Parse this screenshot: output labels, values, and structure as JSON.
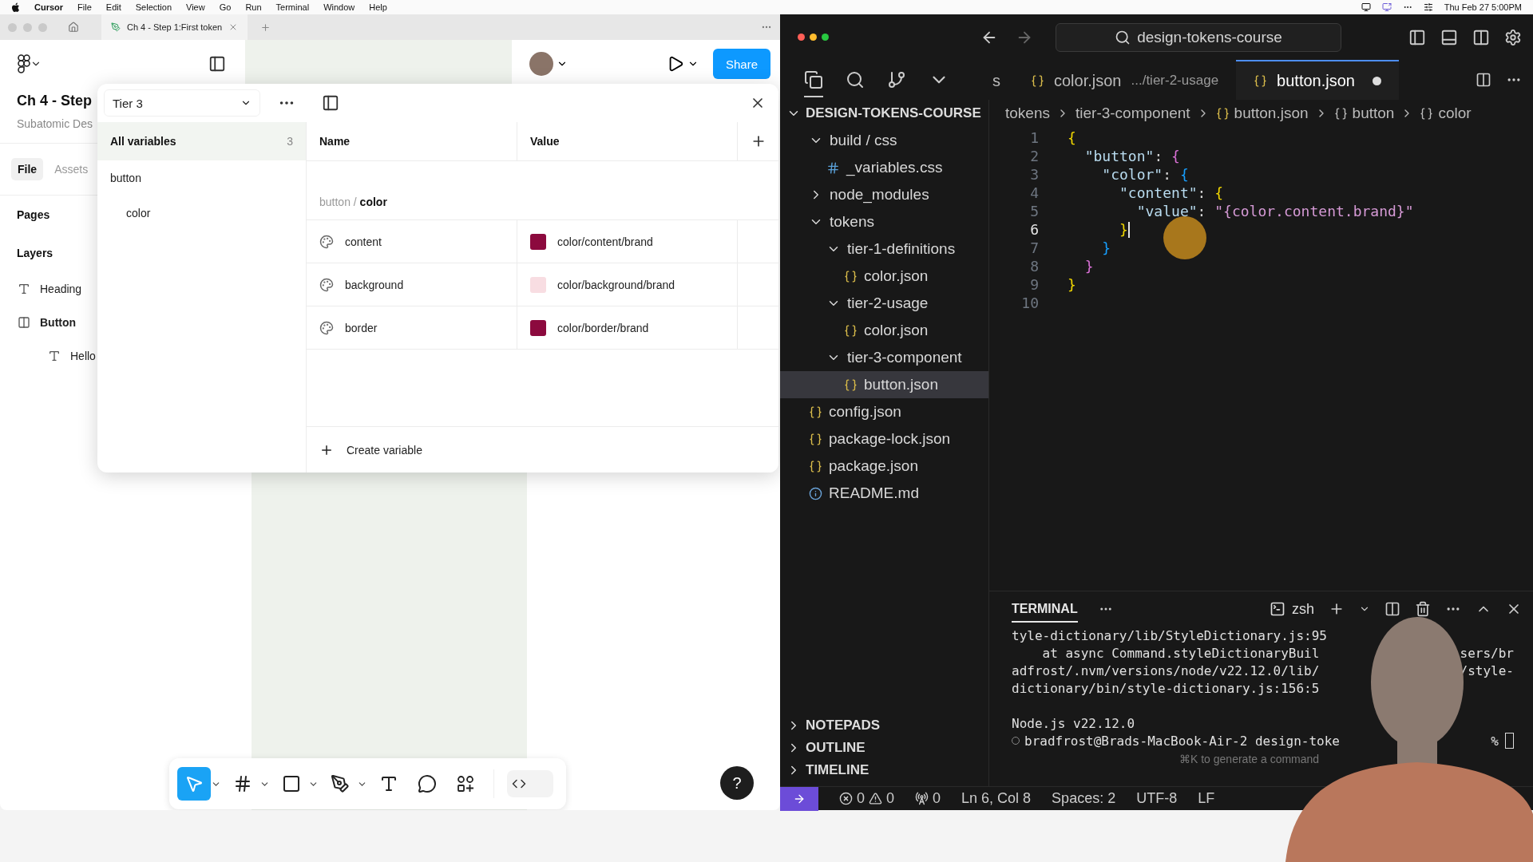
{
  "menu_bar": {
    "app": "Cursor",
    "items": [
      "File",
      "Edit",
      "Selection",
      "View",
      "Go",
      "Run",
      "Terminal",
      "Window",
      "Help"
    ],
    "clock": "Thu Feb 27  5:00PM"
  },
  "figma": {
    "tab": {
      "title": "Ch 4 - Step 1:First token"
    },
    "share": "Share",
    "file_title": "Ch 4 - Step",
    "team": "Subatomic Des",
    "panel_tabs": [
      {
        "label": "File",
        "selected": true
      },
      {
        "label": "Assets",
        "selected": false
      }
    ],
    "pages_label": "Pages",
    "layers_label": "Layers",
    "layers": [
      {
        "kind": "text",
        "name": "Heading",
        "selected": false
      },
      {
        "kind": "frame",
        "name": "Button",
        "selected": true,
        "children": [
          {
            "kind": "text",
            "name": "Hello",
            "selected": false
          }
        ]
      }
    ],
    "variables": {
      "collection": "Tier 3",
      "all": {
        "label": "All variables",
        "count": "3",
        "selected": true
      },
      "groups": [
        {
          "label": "button",
          "selected": false,
          "children": [
            {
              "label": "color",
              "selected": false
            }
          ]
        }
      ],
      "columns": [
        "Name",
        "Value"
      ],
      "path": {
        "parent": "button",
        "separator": "/",
        "current": "color"
      },
      "rows": [
        {
          "name": "content",
          "value": "color/content/brand",
          "color": "#8c0a3e"
        },
        {
          "name": "background",
          "value": "color/background/brand",
          "color": "#f8dde2"
        },
        {
          "name": "border",
          "value": "color/border/brand",
          "color": "#8c0a3e"
        }
      ],
      "create": "Create variable"
    },
    "tools": [
      {
        "kind": "move",
        "selected": true,
        "menu": true
      },
      {
        "kind": "frame",
        "selected": false,
        "menu": true
      },
      {
        "kind": "rectangle",
        "selected": false,
        "menu": true
      },
      {
        "kind": "pen",
        "selected": false,
        "menu": true
      },
      {
        "kind": "text",
        "selected": false
      },
      {
        "kind": "comment",
        "selected": false
      },
      {
        "kind": "components",
        "selected": false
      }
    ],
    "dev_mode": {
      "on": false
    },
    "help": "?"
  },
  "vscode": {
    "search": "design-tokens-course",
    "tabs": [
      {
        "label": "s",
        "selected": false,
        "modified": false
      },
      {
        "label": "color.json",
        "detail": ".../tier-2-usage",
        "selected": false,
        "modified": false
      },
      {
        "label": "button.json",
        "selected": true,
        "modified": true
      }
    ],
    "explorer": {
      "title": "DESIGN-TOKENS-COURSE",
      "tree": [
        {
          "label": "build / css",
          "kind": "folder",
          "expanded": true,
          "selected": false,
          "children": [
            {
              "label": "_variables.css",
              "kind": "css",
              "selected": false
            }
          ]
        },
        {
          "label": "node_modules",
          "kind": "folder",
          "expanded": false,
          "selected": false
        },
        {
          "label": "tokens",
          "kind": "folder",
          "expanded": true,
          "selected": false,
          "children": [
            {
              "label": "tier-1-definitions",
              "kind": "folder",
              "expanded": true,
              "selected": false,
              "children": [
                {
                  "label": "color.json",
                  "kind": "json",
                  "selected": false
                }
              ]
            },
            {
              "label": "tier-2-usage",
              "kind": "folder",
              "expanded": true,
              "selected": false,
              "children": [
                {
                  "label": "color.json",
                  "kind": "json",
                  "selected": false
                }
              ]
            },
            {
              "label": "tier-3-component",
              "kind": "folder",
              "expanded": true,
              "selected": false,
              "children": [
                {
                  "label": "button.json",
                  "kind": "json",
                  "selected": true
                }
              ]
            }
          ]
        },
        {
          "label": "config.json",
          "kind": "json",
          "selected": false
        },
        {
          "label": "package-lock.json",
          "kind": "json",
          "selected": false
        },
        {
          "label": "package.json",
          "kind": "json",
          "selected": false
        },
        {
          "label": "README.md",
          "kind": "info",
          "selected": false
        }
      ],
      "sections": [
        "NOTEPADS",
        "OUTLINE",
        "TIMELINE"
      ]
    },
    "breadcrumb": [
      {
        "label": "tokens",
        "kind": "folder"
      },
      {
        "label": "tier-3-component",
        "kind": "folder"
      },
      {
        "label": "button.json",
        "kind": "json"
      },
      {
        "label": "button",
        "kind": "object"
      },
      {
        "label": "color",
        "kind": "object"
      }
    ],
    "code": [
      {
        "number": "1",
        "current": false,
        "tokens": [
          {
            "text": "{",
            "kind": "brace",
            "color": "#f1d700"
          }
        ]
      },
      {
        "number": "2",
        "current": false,
        "tokens": [
          {
            "text": "  \"button\"",
            "kind": "key"
          },
          {
            "text": ": ",
            "kind": "punct"
          },
          {
            "text": "{",
            "kind": "brace",
            "color": "#da70d6"
          }
        ]
      },
      {
        "number": "3",
        "current": false,
        "tokens": [
          {
            "text": "    \"color\"",
            "kind": "key"
          },
          {
            "text": ": ",
            "kind": "punct"
          },
          {
            "text": "{",
            "kind": "brace",
            "color": "#179fff"
          }
        ]
      },
      {
        "number": "4",
        "current": false,
        "tokens": [
          {
            "text": "      \"content\"",
            "kind": "key"
          },
          {
            "text": ": ",
            "kind": "punct"
          },
          {
            "text": "{",
            "kind": "brace",
            "color": "#f1d700"
          }
        ]
      },
      {
        "number": "5",
        "current": false,
        "tokens": [
          {
            "text": "        \"value\"",
            "kind": "key"
          },
          {
            "text": ": ",
            "kind": "punct"
          },
          {
            "text": "\"{color.content.brand}\"",
            "kind": "string"
          }
        ]
      },
      {
        "number": "6",
        "current": true,
        "tokens": [
          {
            "text": "      }",
            "kind": "brace",
            "color": "#f1d700"
          }
        ]
      },
      {
        "number": "7",
        "current": false,
        "tokens": [
          {
            "text": "    }",
            "kind": "brace",
            "color": "#179fff"
          }
        ]
      },
      {
        "number": "8",
        "current": false,
        "tokens": [
          {
            "text": "  }",
            "kind": "brace",
            "color": "#da70d6"
          }
        ]
      },
      {
        "number": "9",
        "current": false,
        "tokens": [
          {
            "text": "}",
            "kind": "brace",
            "color": "#f1d700"
          }
        ]
      },
      {
        "number": "10",
        "current": false
      }
    ],
    "terminal": {
      "title": "TERMINAL",
      "shell": "zsh",
      "blocks": [
        [
          {
            "kind": "output",
            "left": "tyle-dictionary/lib/StyleDictionary.js:95"
          },
          {
            "kind": "output",
            "left": "    at async Command.styleDictionaryBuil",
            "right": "sers/br"
          },
          {
            "kind": "output",
            "left": "adfrost/.nvm/versions/node/v22.12.0/lib/",
            "right": "/style-"
          },
          {
            "kind": "output",
            "left": "dictionary/bin/style-dictionary.js:156:5"
          }
        ],
        [
          {
            "kind": "output",
            "left": "Node.js v22.12.0"
          },
          {
            "kind": "prompt",
            "left": "bradfrost@Brads-MacBook-Air-2 design-toke",
            "right": "%"
          }
        ]
      ],
      "hint": "⌘K to generate a command"
    },
    "status": {
      "errors": "0",
      "warnings": "0",
      "ports": "0",
      "items": [
        "Ln 6, Col 8",
        "Spaces: 2",
        "UTF-8",
        "LF"
      ]
    }
  }
}
